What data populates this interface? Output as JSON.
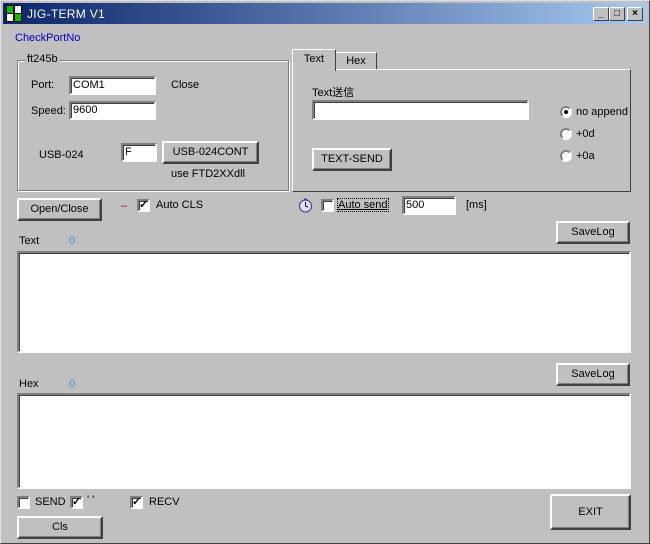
{
  "window": {
    "title": "JIG-TERM V1"
  },
  "check_port": "CheckPortNo",
  "ft245b": {
    "group_label": "ft245b",
    "port_label": "Port:",
    "port_value": "COM1",
    "status": "Close",
    "speed_label": "Speed:",
    "speed_value": "9600",
    "usb_label": "USB-024",
    "usb_value": "F",
    "usb_button": "USB-024CONT",
    "usb_note": "use FTD2XXdll"
  },
  "tabs": [
    {
      "label": "Text"
    },
    {
      "label": "Hex"
    }
  ],
  "text_panel": {
    "label": "Text送信",
    "input_value": "",
    "send_button": "TEXT-SEND",
    "radios": [
      {
        "label": "no append",
        "selected": true
      },
      {
        "label": "+0d",
        "selected": false
      },
      {
        "label": "+0a",
        "selected": false
      }
    ]
  },
  "open_close_button": "Open/Close",
  "dash_mark": "–",
  "auto_cls": {
    "label": "Auto CLS",
    "checked": true
  },
  "auto_send": {
    "label": "Auto send",
    "checked": false,
    "interval": "500",
    "unit": "[ms]"
  },
  "text_log": {
    "label": "Text",
    "count": "0",
    "save_button": "SaveLog"
  },
  "hex_log": {
    "label": "Hex",
    "count": "0",
    "save_button": "SaveLog"
  },
  "footer": {
    "send_label": "SEND",
    "send_checked": false,
    "quote_label": "' '",
    "quote_checked": true,
    "recv_label": "RECV",
    "recv_checked": true,
    "cls_button": "Cls",
    "exit_button": "EXIT"
  }
}
